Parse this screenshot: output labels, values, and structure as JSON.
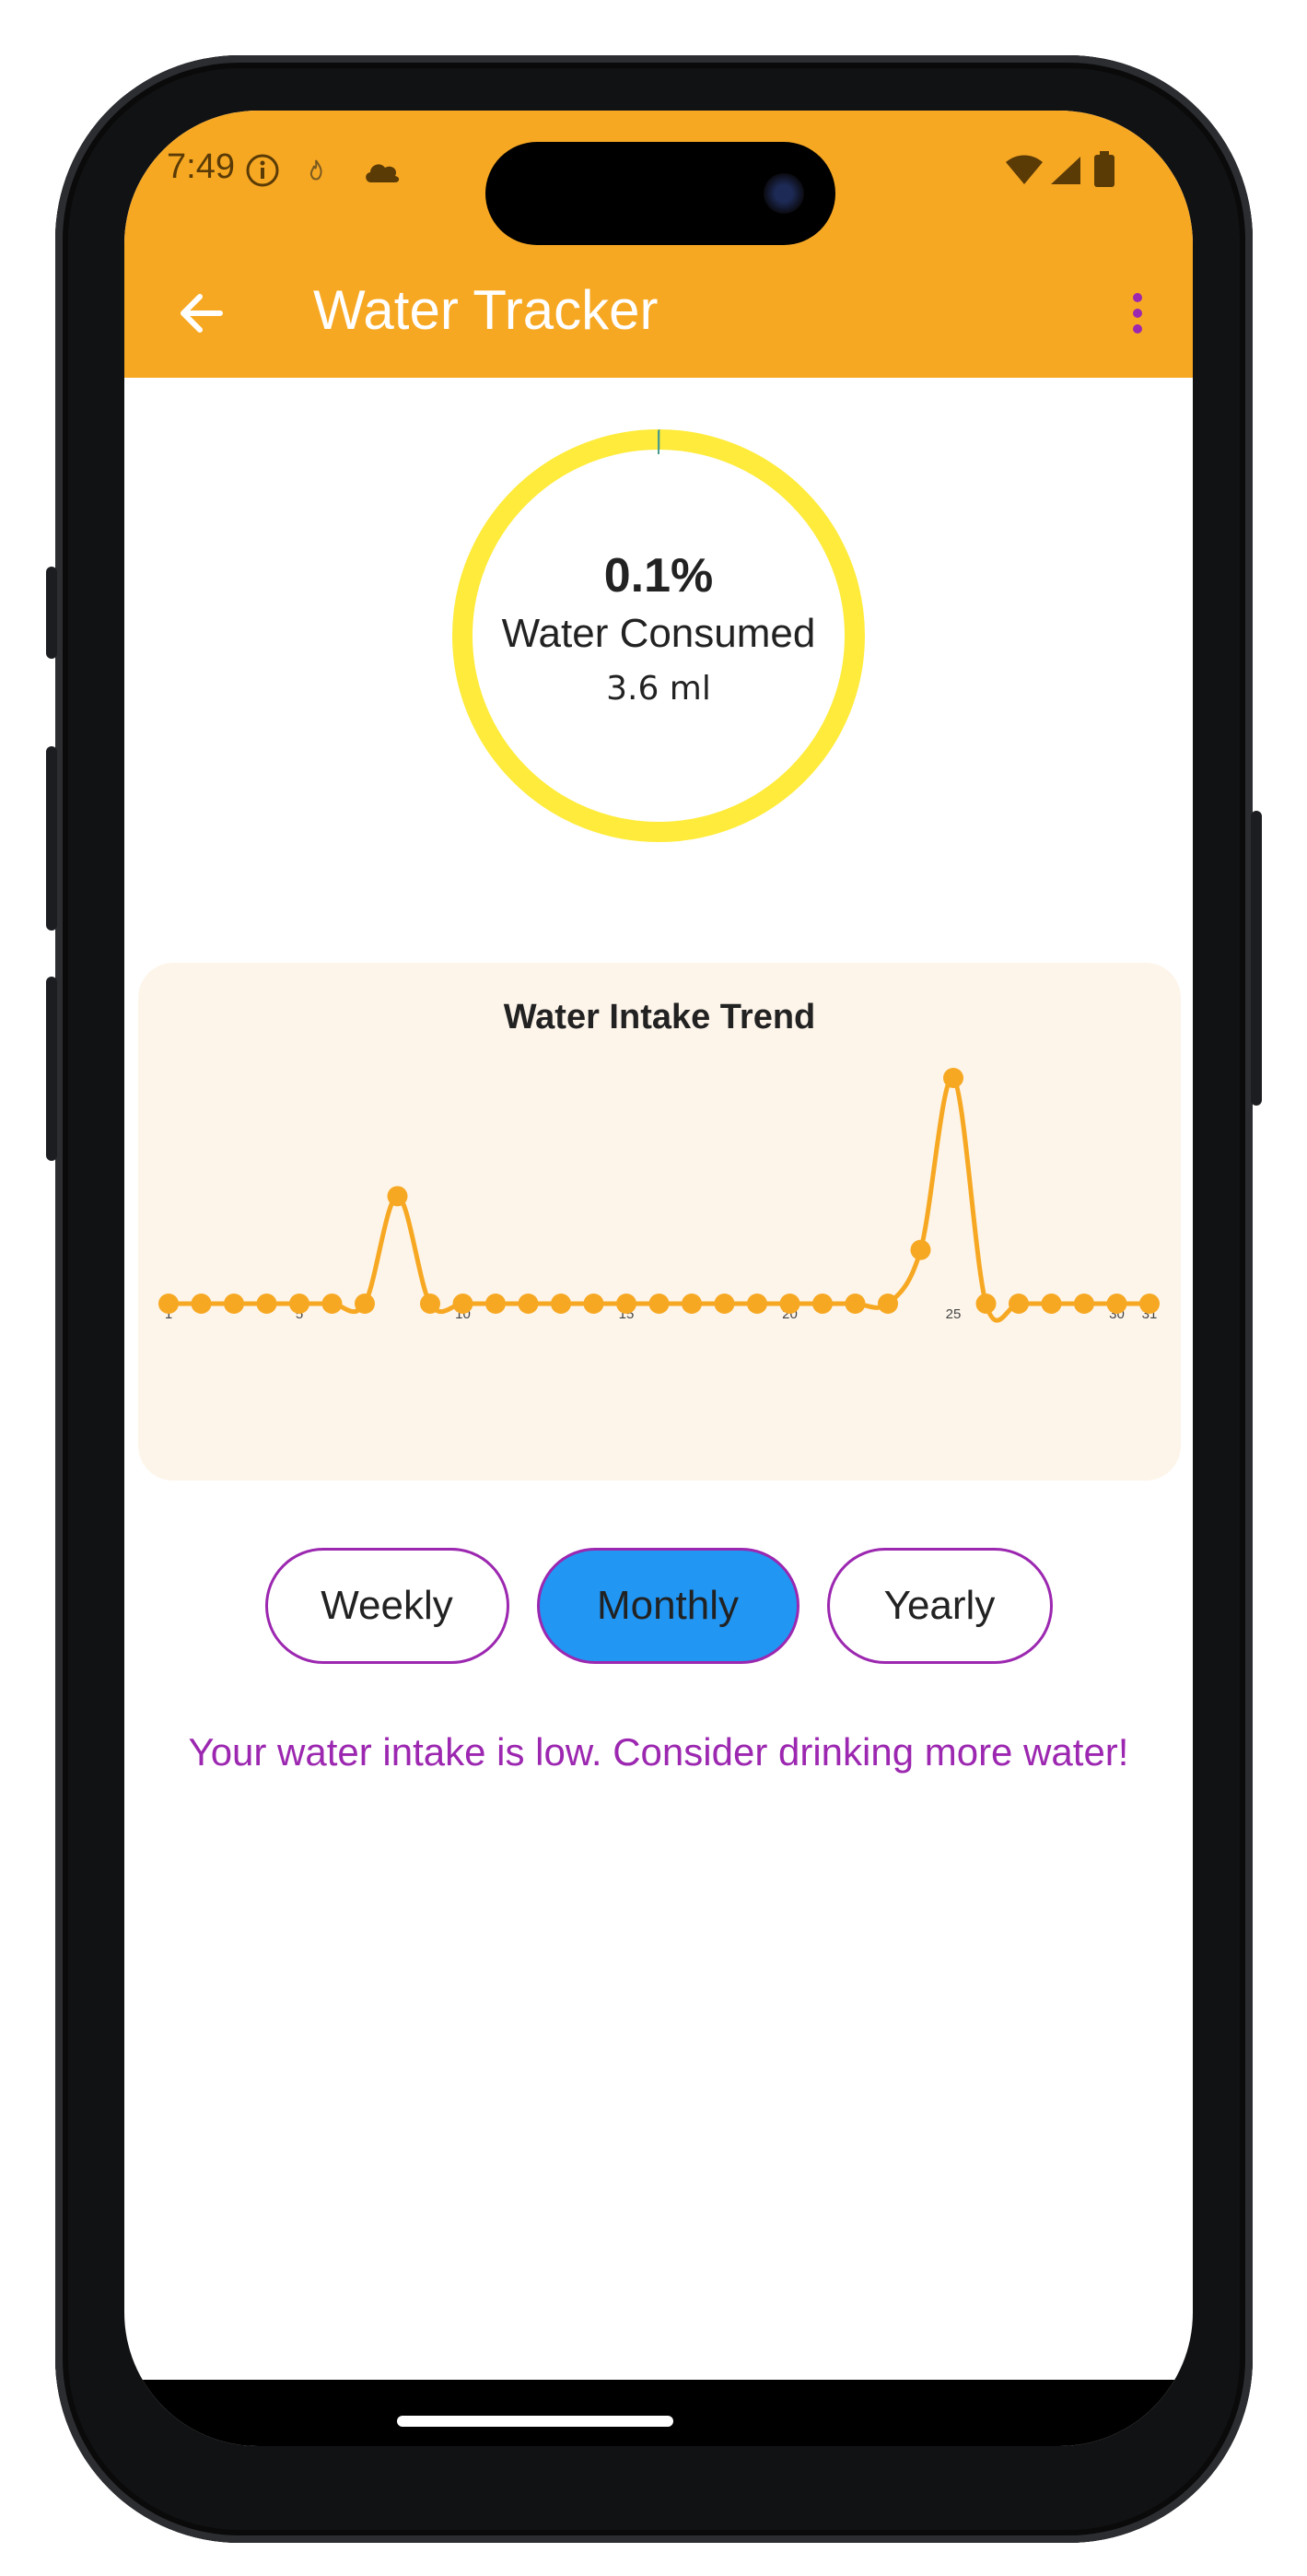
{
  "status": {
    "time": "7:49",
    "icons": [
      "info-icon",
      "flame-icon",
      "cloud-icon",
      "wifi-icon",
      "signal-icon",
      "battery-icon"
    ]
  },
  "appbar": {
    "title": "Water Tracker",
    "back_icon": "arrow-left-icon",
    "menu_icon": "more-vert-icon"
  },
  "progress": {
    "percent_label": "0.1%",
    "label": "Water Consumed",
    "amount": "3.6 ml",
    "fraction": 0.001
  },
  "chart_data": {
    "type": "line",
    "title": "Water Intake Trend",
    "x_tick_labels": [
      "1",
      "5",
      "10",
      "15",
      "20",
      "25",
      "30",
      "31"
    ],
    "x": [
      1,
      2,
      3,
      4,
      5,
      6,
      7,
      8,
      9,
      10,
      11,
      12,
      13,
      14,
      15,
      16,
      17,
      18,
      19,
      20,
      21,
      22,
      23,
      24,
      25,
      26,
      27,
      28,
      29,
      30,
      31
    ],
    "values": [
      0,
      0,
      0,
      0,
      0,
      0,
      0,
      1,
      0,
      0,
      0,
      0,
      0,
      0,
      0,
      0,
      0,
      0,
      0,
      0,
      0,
      0,
      0,
      0.5,
      2.1,
      0,
      0,
      0,
      0,
      0,
      0
    ],
    "xlim": [
      1,
      31
    ],
    "ylim": [
      0,
      2.1
    ],
    "grid": false,
    "color": "#F7A823"
  },
  "segment": {
    "options": [
      "Weekly",
      "Monthly",
      "Yearly"
    ],
    "selected": "Monthly"
  },
  "message": "Your water intake is low. Consider drinking more water!",
  "colors": {
    "appbar": "#F7A823",
    "ring": "#FFEB3B",
    "accent": "#9C27B0",
    "selected": "#2196F3",
    "card": "#FDF5EA"
  }
}
